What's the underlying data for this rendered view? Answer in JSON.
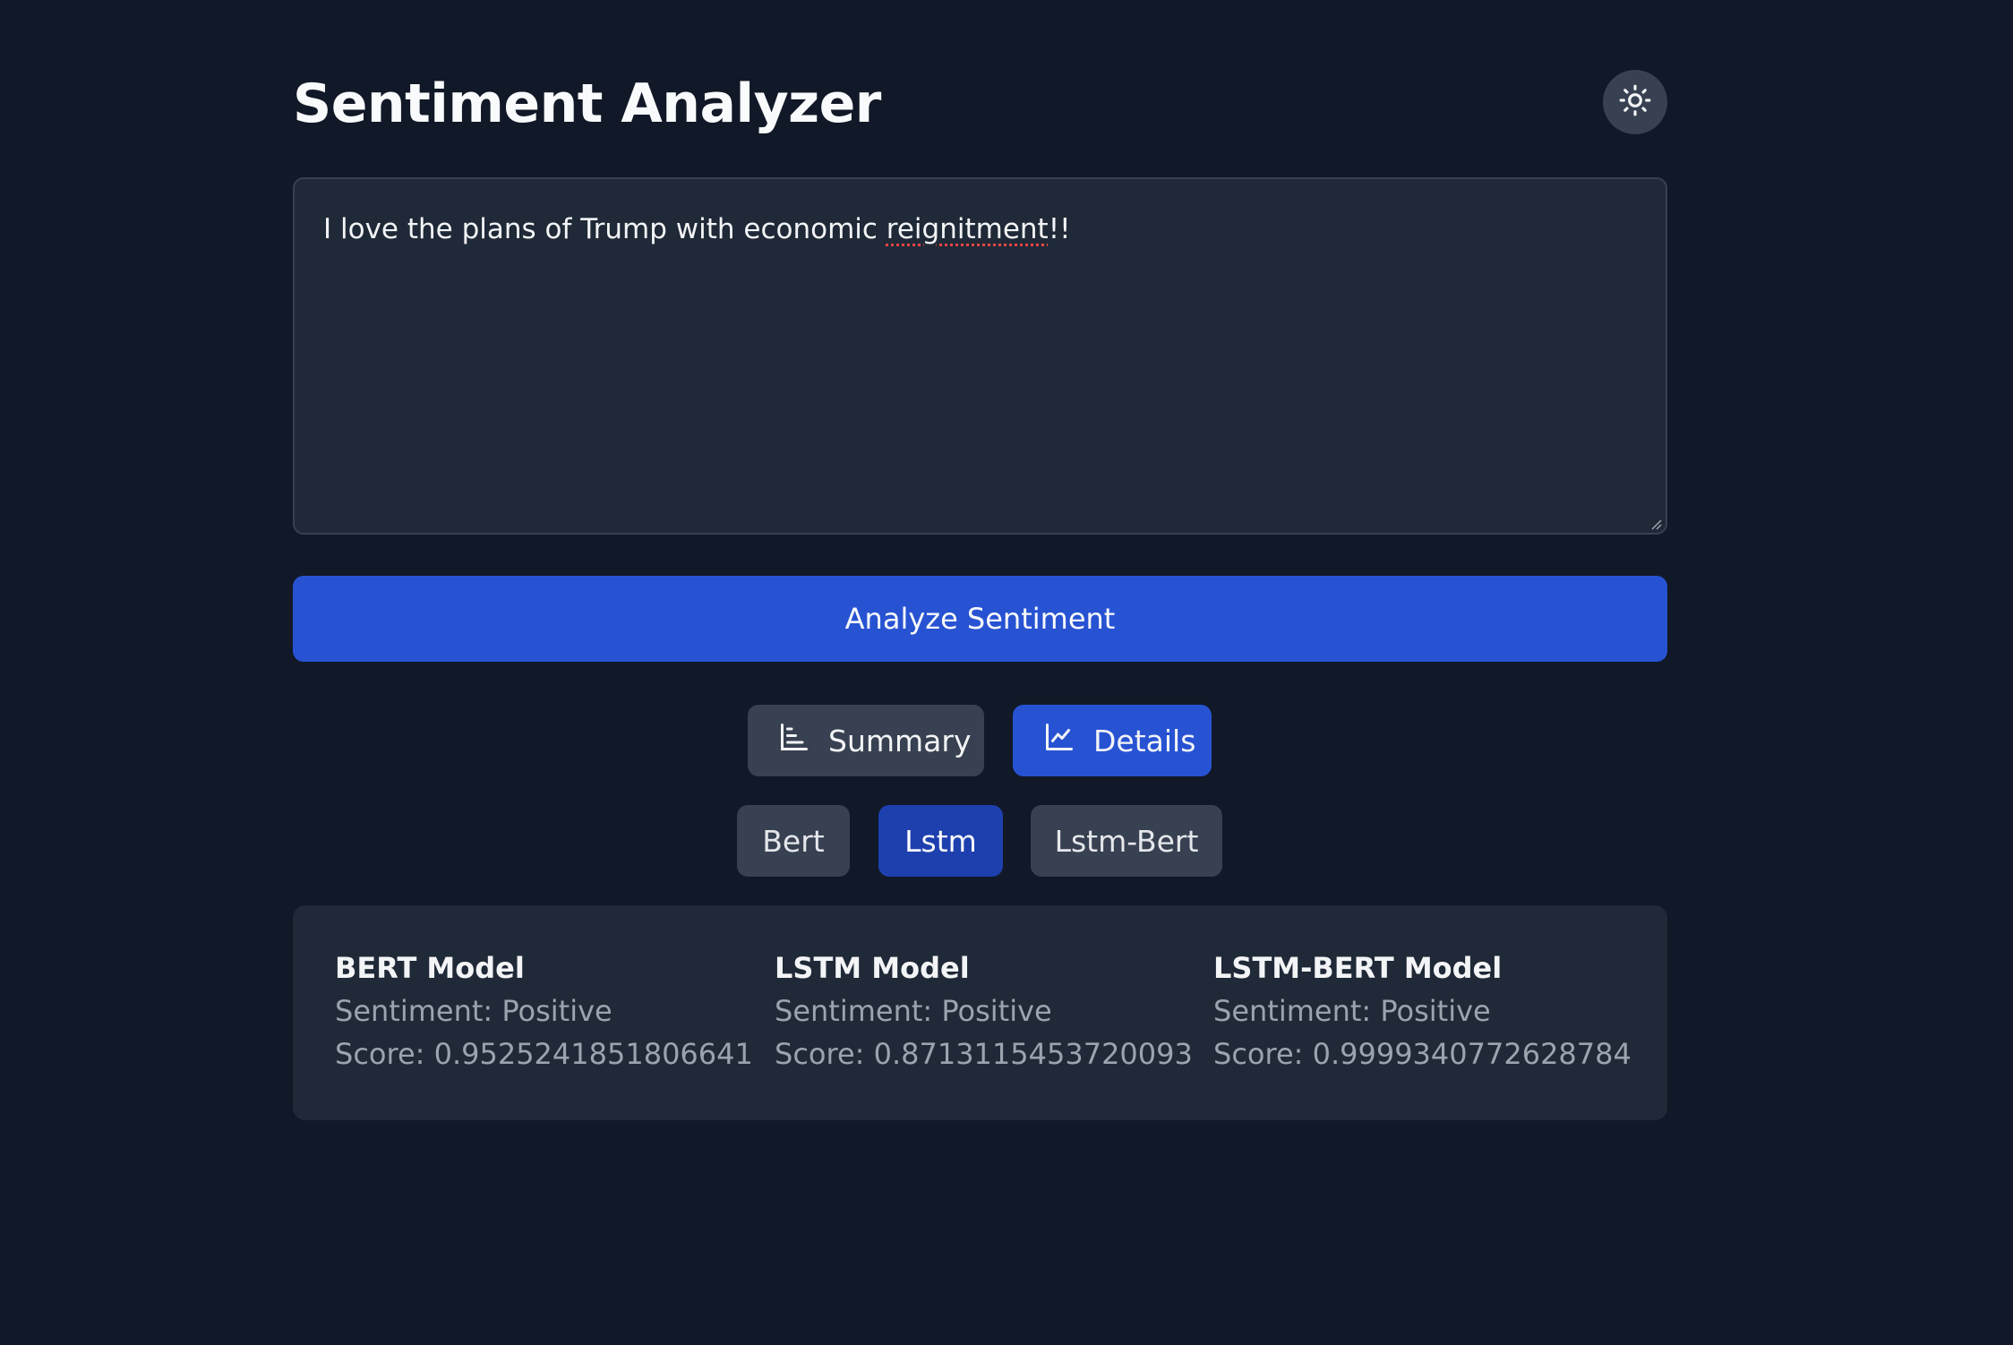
{
  "header": {
    "title": "Sentiment Analyzer",
    "theme_toggle_icon": "sun-icon"
  },
  "input": {
    "text_before": "I love the plans of Trump with economic ",
    "text_misspelled": "reignitment",
    "text_after": "!!"
  },
  "analyze_button": {
    "label": "Analyze Sentiment"
  },
  "view_tabs": [
    {
      "label": "Summary",
      "icon": "bar-chart-icon",
      "active": false
    },
    {
      "label": "Details",
      "icon": "line-chart-icon",
      "active": true
    }
  ],
  "model_tabs": [
    {
      "label": "Bert",
      "active": false
    },
    {
      "label": "Lstm",
      "active": true
    },
    {
      "label": "Lstm-Bert",
      "active": false
    }
  ],
  "results": [
    {
      "model": "BERT Model",
      "sentiment": "Sentiment: Positive",
      "score": "Score: 0.9525241851806641"
    },
    {
      "model": "LSTM Model",
      "sentiment": "Sentiment: Positive",
      "score": "Score: 0.8713115453720093"
    },
    {
      "model": "LSTM-BERT Model",
      "sentiment": "Sentiment: Positive",
      "score": "Score: 0.9999340772628784"
    }
  ],
  "colors": {
    "background": "#111827",
    "panel": "#1f2937",
    "button_secondary": "#374151",
    "accent": "#2753d3",
    "accent_dark": "#1e40af",
    "muted_text": "#9ca3af"
  }
}
